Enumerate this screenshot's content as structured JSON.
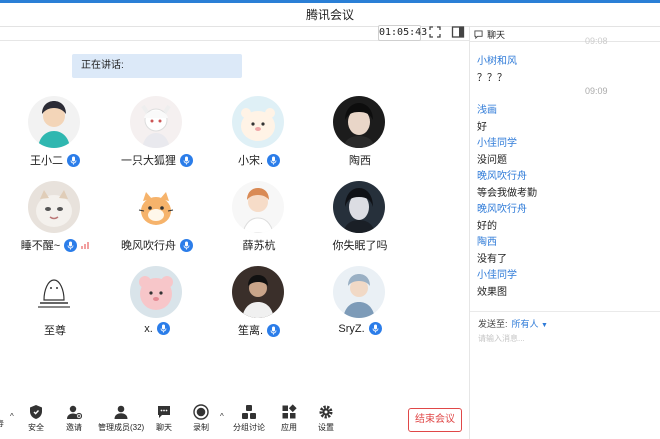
{
  "window": {
    "title": "腾讯会议"
  },
  "meeting": {
    "timer": "01:05:43",
    "speaking_label": "正在讲话:",
    "participants": [
      {
        "name": "王小二",
        "mic": true,
        "signal": false
      },
      {
        "name": "一只大狐狸",
        "mic": true,
        "signal": false
      },
      {
        "name": "小宋.",
        "mic": true,
        "signal": false
      },
      {
        "name": "陶西",
        "mic": false,
        "signal": false
      },
      {
        "name": "睡不醒~",
        "mic": true,
        "signal": true
      },
      {
        "name": "晚风吹行舟",
        "mic": true,
        "signal": false
      },
      {
        "name": "薛苏杭",
        "mic": false,
        "signal": false
      },
      {
        "name": "你失眠了吗",
        "mic": false,
        "signal": false
      },
      {
        "name": "至尊",
        "mic": false,
        "signal": false
      },
      {
        "name": "x.",
        "mic": true,
        "signal": false
      },
      {
        "name": "笙离.",
        "mic": true,
        "signal": false
      },
      {
        "name": "SryZ.",
        "mic": true,
        "signal": false
      }
    ]
  },
  "toolbar": {
    "partial_left": "寿",
    "security": "安全",
    "invite": "邀请",
    "manage": "管理成员(32)",
    "chat": "聊天",
    "record": "录制",
    "breakout": "分组讨论",
    "apps": "应用",
    "settings": "设置",
    "end": "结束会议"
  },
  "chat": {
    "title": "聊天",
    "timestamp_top": "09:08",
    "timestamp": "09:09",
    "messages": [
      {
        "name": "小树和风",
        "text": "？？？"
      },
      {
        "name": "浅画",
        "text": "好"
      },
      {
        "name": "小佳同学",
        "text": "没问题"
      },
      {
        "name": "晚风吹行舟",
        "text": "等会我做考勤"
      },
      {
        "name": "晚风吹行舟",
        "text": "好的"
      },
      {
        "name": "陶西",
        "text": "没有了"
      },
      {
        "name": "小佳同学",
        "text": "效果图"
      }
    ],
    "send_to_label": "发送至:",
    "send_to_value": "所有人",
    "input_placeholder": "请输入消息..."
  },
  "colors": {
    "accent": "#2f7bd8",
    "end_red": "#e04848",
    "speaking_bg": "#dce9f8"
  }
}
